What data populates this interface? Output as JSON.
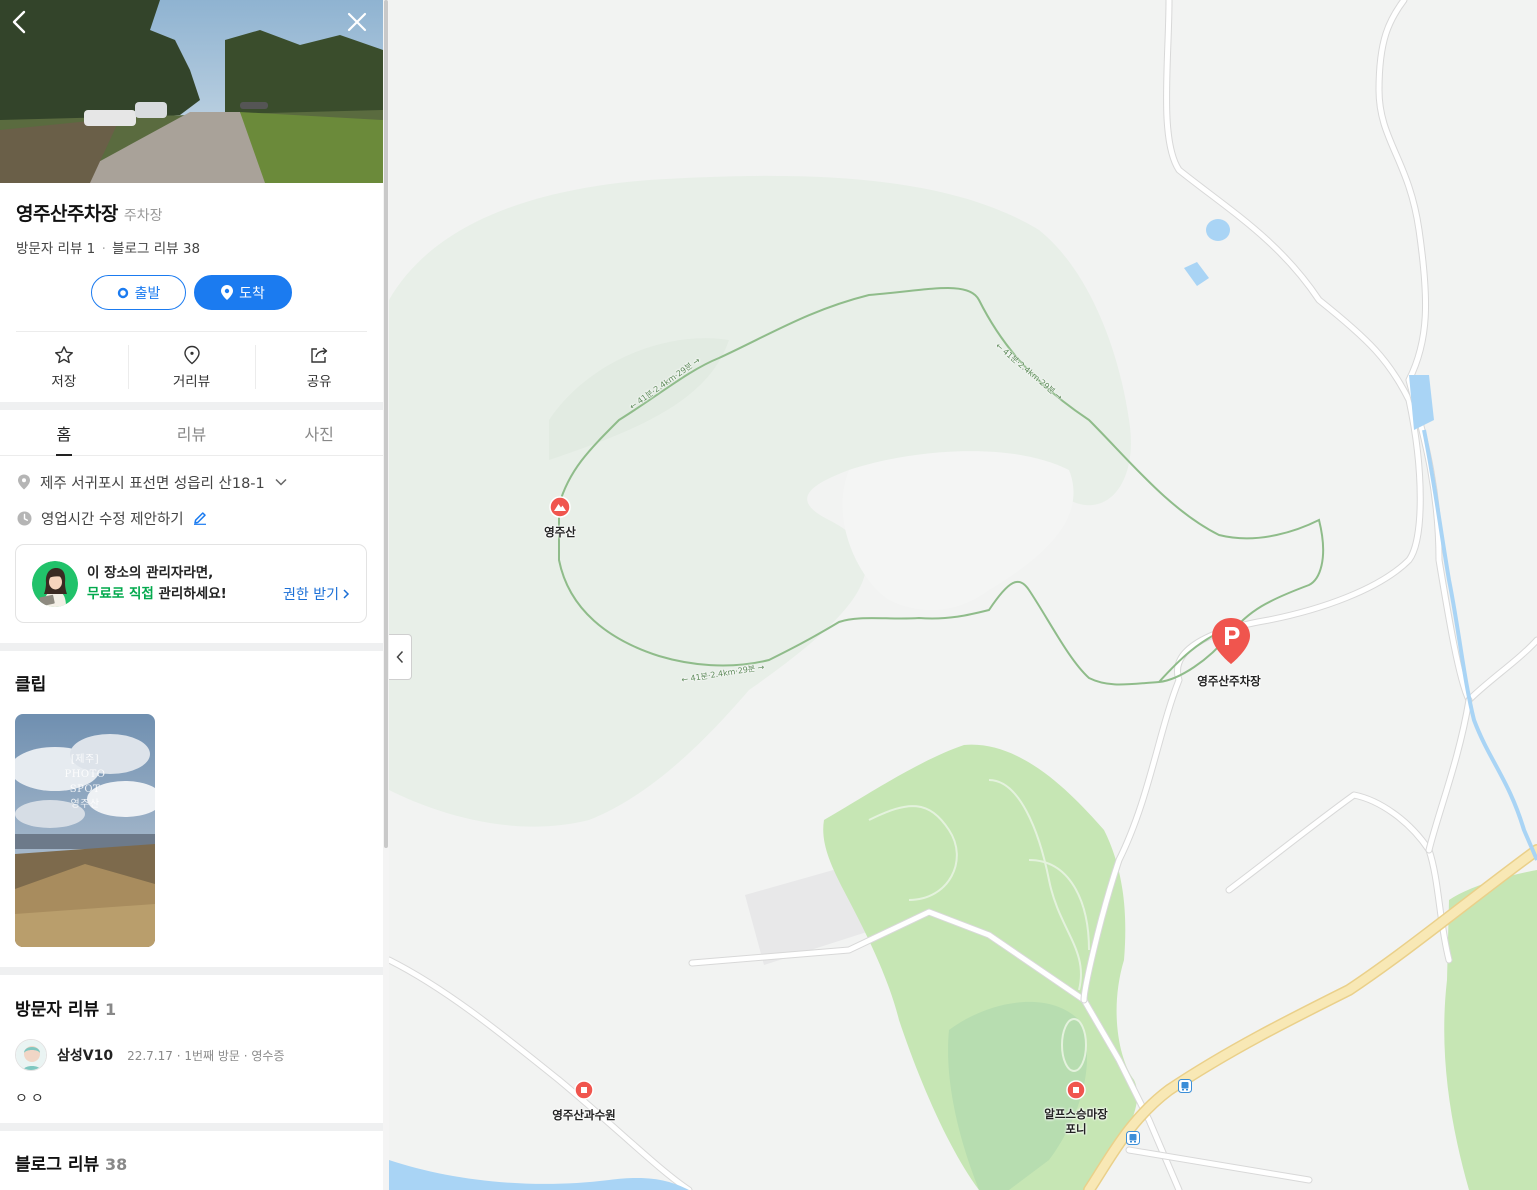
{
  "place": {
    "name": "영주산주차장",
    "category": "주차장",
    "visitor_review_label": "방문자 리뷰 1",
    "blog_review_label": "블로그 리뷰 38",
    "separator": "·"
  },
  "route": {
    "origin_label": "출발",
    "destination_label": "도착"
  },
  "actions": {
    "save": "저장",
    "streetview": "거리뷰",
    "share": "공유"
  },
  "tabs": {
    "home": "홈",
    "review": "리뷰",
    "photo": "사진"
  },
  "info": {
    "address": "제주 서귀포시 표선면 성읍리 산18-1",
    "hours": "영업시간 수정 제안하기"
  },
  "owner_banner": {
    "line1": "이 장소의 관리자라면,",
    "line2_highlight": "무료로 직접",
    "line2_rest": " 관리하세요!",
    "link": "권한 받기"
  },
  "clip": {
    "title": "클립",
    "overlay_lines": [
      "[제주]",
      "PHOTO",
      "SPOT",
      "영주산"
    ]
  },
  "visitor_reviews": {
    "title": "방문자 리뷰",
    "count": "1",
    "items": [
      {
        "author": "삼성V10",
        "meta": "22.7.17 · 1번째 방문 · 영수증",
        "body": "ㅇㅇ"
      }
    ]
  },
  "blog_reviews": {
    "title": "블로그 리뷰",
    "count": "38"
  },
  "map": {
    "labels": {
      "mountain": "영주산",
      "parking": "영주산주차장",
      "orchard": "영주산과수원",
      "ranch_line1": "알프스승마장",
      "ranch_line2": "포니",
      "trail_top_left": "← 41분·2.4km·29분 →",
      "trail_top_right": "← 41분·2.4km·29분 →",
      "trail_bottom": "← 41분·2.4km·29분 →"
    },
    "colors": {
      "base": "#f2f3f2",
      "forest": "#e8efe8",
      "park": "#c6e6b4",
      "trail": "#8fbc8a",
      "road": "#ffffff",
      "highway": "#f7e3a3",
      "water": "#a9d4f5",
      "poi_red": "#f0554e"
    }
  }
}
